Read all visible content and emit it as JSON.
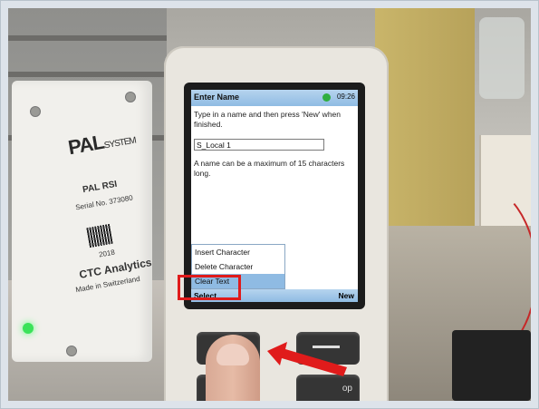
{
  "device_screen": {
    "title": "Enter Name",
    "time": "09:26",
    "instruction": "Type in a name and then press 'New' when finished.",
    "name_value": "S_Local 1",
    "hint": "A name can be a maximum of 15 characters long.",
    "menu": [
      {
        "label": "Insert Character",
        "selected": false
      },
      {
        "label": "Delete Character",
        "selected": false
      },
      {
        "label": "Clear Text",
        "selected": true
      }
    ],
    "softkey_left": "Select",
    "softkey_right": "New"
  },
  "module": {
    "logo_main": "PAL",
    "logo_sub": "SYSTEM",
    "model": "PAL RSI",
    "serial": "Serial No. 373080",
    "date": "2018",
    "brand": "CTC Analytics",
    "origin": "Made in Switzerland"
  },
  "hardware": {
    "stop_label": "op"
  },
  "colors": {
    "highlight": "#e01b1b",
    "titlebar": "#8fbbe3",
    "selected": "#8fbbe3"
  }
}
